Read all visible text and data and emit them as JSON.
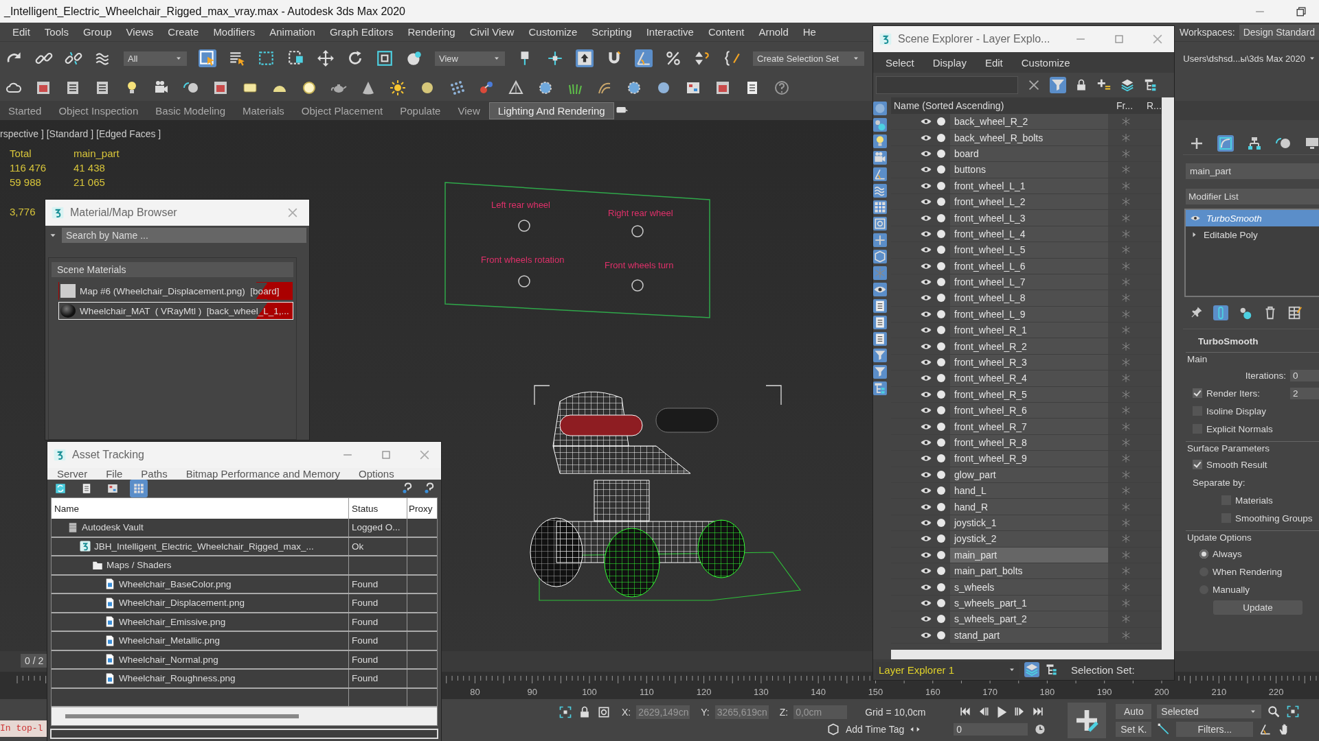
{
  "window": {
    "title": "_Intelligent_Electric_Wheelchair_Rigged_max_vray.max - Autodesk 3ds Max 2020"
  },
  "menu_bar": {
    "items": [
      "Edit",
      "Tools",
      "Group",
      "Views",
      "Create",
      "Modifiers",
      "Animation",
      "Graph Editors",
      "Rendering",
      "Civil View",
      "Customize",
      "Scripting",
      "Interactive",
      "Content",
      "Arnold",
      "He"
    ],
    "workspaces_label": "Workspaces:",
    "workspace": "Design Standard"
  },
  "toolbar": {
    "selection_filter": "All",
    "reference_coordinate": "View",
    "selection_set": "Create Selection Set",
    "project_path": "Users\\dshsd...ы\\3ds Max 2020"
  },
  "ribbon_tabs": [
    {
      "label": "Started",
      "selected": false
    },
    {
      "label": "Object Inspection",
      "selected": false
    },
    {
      "label": "Basic Modeling",
      "selected": false
    },
    {
      "label": "Materials",
      "selected": false
    },
    {
      "label": "Object Placement",
      "selected": false
    },
    {
      "label": "Populate",
      "selected": false
    },
    {
      "label": "View",
      "selected": false
    },
    {
      "label": "Lighting And Rendering",
      "selected": true
    }
  ],
  "viewport": {
    "label": "rspective ] [Standard ] [Edged Faces ]",
    "stats": {
      "headers": [
        "Total",
        "main_part"
      ],
      "rows": [
        [
          "116 476",
          "41 438"
        ],
        [
          "59 988",
          "21 065"
        ]
      ],
      "fps": "3,776"
    },
    "rig_panel": {
      "labels": [
        "Left rear wheel",
        "Right rear wheel",
        "Front wheels rotation",
        "Front wheels turn"
      ]
    }
  },
  "command_panel": {
    "object_name": "main_part",
    "modifier_list": "Modifier List",
    "stack": [
      {
        "label": "TurboSmooth",
        "kind": "modifier",
        "selected": true
      },
      {
        "label": "Editable Poly",
        "kind": "base",
        "selected": false
      }
    ],
    "rollout": {
      "title": "TurboSmooth",
      "groups": [
        {
          "title": "Main",
          "items": [
            {
              "kind": "spinner",
              "label": "Iterations:",
              "value": "0"
            },
            {
              "kind": "check_spinner",
              "label": "Render Iters:",
              "checked": true,
              "value": "2"
            },
            {
              "kind": "checkbox",
              "label": "Isoline Display",
              "checked": false
            },
            {
              "kind": "checkbox",
              "label": "Explicit Normals",
              "checked": false
            }
          ]
        },
        {
          "title": "Surface Parameters",
          "items": [
            {
              "kind": "checkbox",
              "label": "Smooth Result",
              "checked": true
            },
            {
              "kind": "text",
              "label": "Separate by:"
            },
            {
              "kind": "sub_checkbox",
              "label": "Materials",
              "checked": false
            },
            {
              "kind": "sub_checkbox",
              "label": "Smoothing Groups",
              "checked": false
            }
          ]
        },
        {
          "title": "Update Options",
          "items": [
            {
              "kind": "radio",
              "label": "Always",
              "selected": true
            },
            {
              "kind": "radio",
              "label": "When Rendering",
              "selected": false
            },
            {
              "kind": "radio",
              "label": "Manually",
              "selected": false
            },
            {
              "kind": "button",
              "label": "Update"
            }
          ]
        }
      ]
    }
  },
  "scene_explorer": {
    "title": "Scene Explorer - Layer Explo...",
    "menus": [
      "Select",
      "Display",
      "Edit",
      "Customize"
    ],
    "columns": [
      "Name (Sorted Ascending)",
      "Fr...",
      "R..."
    ],
    "rows": [
      {
        "name": "back_wheel_R_2",
        "selected": false
      },
      {
        "name": "back_wheel_R_bolts",
        "selected": false
      },
      {
        "name": "board",
        "selected": false
      },
      {
        "name": "buttons",
        "selected": false
      },
      {
        "name": "front_wheel_L_1",
        "selected": false
      },
      {
        "name": "front_wheel_L_2",
        "selected": false
      },
      {
        "name": "front_wheel_L_3",
        "selected": false
      },
      {
        "name": "front_wheel_L_4",
        "selected": false
      },
      {
        "name": "front_wheel_L_5",
        "selected": false
      },
      {
        "name": "front_wheel_L_6",
        "selected": false
      },
      {
        "name": "front_wheel_L_7",
        "selected": false
      },
      {
        "name": "front_wheel_L_8",
        "selected": false
      },
      {
        "name": "front_wheel_L_9",
        "selected": false
      },
      {
        "name": "front_wheel_R_1",
        "selected": false
      },
      {
        "name": "front_wheel_R_2",
        "selected": false
      },
      {
        "name": "front_wheel_R_3",
        "selected": false
      },
      {
        "name": "front_wheel_R_4",
        "selected": false
      },
      {
        "name": "front_wheel_R_5",
        "selected": false
      },
      {
        "name": "front_wheel_R_6",
        "selected": false
      },
      {
        "name": "front_wheel_R_7",
        "selected": false
      },
      {
        "name": "front_wheel_R_8",
        "selected": false
      },
      {
        "name": "front_wheel_R_9",
        "selected": false
      },
      {
        "name": "glow_part",
        "selected": false
      },
      {
        "name": "hand_L",
        "selected": false
      },
      {
        "name": "hand_R",
        "selected": false
      },
      {
        "name": "joystick_1",
        "selected": false
      },
      {
        "name": "joystick_2",
        "selected": false
      },
      {
        "name": "main_part",
        "selected": true
      },
      {
        "name": "main_part_bolts",
        "selected": false
      },
      {
        "name": "s_wheels",
        "selected": false
      },
      {
        "name": "s_wheels_part_1",
        "selected": false
      },
      {
        "name": "s_wheels_part_2",
        "selected": false
      },
      {
        "name": "stand_part",
        "selected": false
      }
    ],
    "layer": "Layer Explorer 1",
    "selection_set_label": "Selection Set:"
  },
  "material_browser": {
    "title": "Material/Map Browser",
    "search": {
      "placeholder": "Search by Name ..."
    },
    "group": "Scene Materials",
    "items": [
      {
        "label": "Map #6 (Wheelchair_Displacement.png)  [board]",
        "kind": "map",
        "selected": false
      },
      {
        "label": "Wheelchair_MAT  ( VRayMtl )  [back_wheel_L_1,...",
        "kind": "material",
        "selected": true
      }
    ]
  },
  "asset_tracking": {
    "title": "Asset Tracking",
    "menus": [
      "Server",
      "File",
      "Paths",
      "Bitmap Performance and Memory",
      "Options"
    ],
    "toolbar_buttons": [
      {
        "selected": false
      },
      {
        "selected": false
      },
      {
        "selected": false
      },
      {
        "selected": true
      }
    ],
    "columns": [
      "Name",
      "Status",
      "Proxy"
    ],
    "rows": [
      {
        "kind": "vault",
        "name": "Autodesk Vault",
        "status": "Logged O...",
        "children": [
          {
            "kind": "scene",
            "name": "JBH_Intelligent_Electric_Wheelchair_Rigged_max_...",
            "status": "Ok",
            "children": [
              {
                "kind": "folder",
                "name": "Maps / Shaders",
                "children": [
                  {
                    "kind": "image",
                    "name": "Wheelchair_BaseColor.png",
                    "status": "Found"
                  },
                  {
                    "kind": "image",
                    "name": "Wheelchair_Displacement.png",
                    "status": "Found"
                  },
                  {
                    "kind": "image",
                    "name": "Wheelchair_Emissive.png",
                    "status": "Found"
                  },
                  {
                    "kind": "image",
                    "name": "Wheelchair_Metallic.png",
                    "status": "Found"
                  },
                  {
                    "kind": "image",
                    "name": "Wheelchair_Normal.png",
                    "status": "Found"
                  },
                  {
                    "kind": "image",
                    "name": "Wheelchair_Roughness.png",
                    "status": "Found"
                  }
                ]
              }
            ]
          }
        ]
      }
    ]
  },
  "timeline": {
    "frame_range": "0 / 2",
    "level": 0,
    "ruler_labels": [
      "80",
      "90",
      "100",
      "110",
      "120",
      "130",
      "140",
      "150",
      "160",
      "170",
      "180",
      "190",
      "200",
      "210",
      "220"
    ]
  },
  "status_bar": {
    "listener": "In top-l",
    "x_label": "X:",
    "x": "2629,149cn",
    "y_label": "Y:",
    "y": "3265,619cn",
    "z_label": "Z:",
    "z": "0,0cm",
    "grid": "Grid = 10,0cm",
    "time_tag": "Add Time Tag",
    "frame": "0",
    "auto_key": "Auto",
    "set_key": "Set K.",
    "key_filter": "Selected",
    "filters": "Filters..."
  }
}
